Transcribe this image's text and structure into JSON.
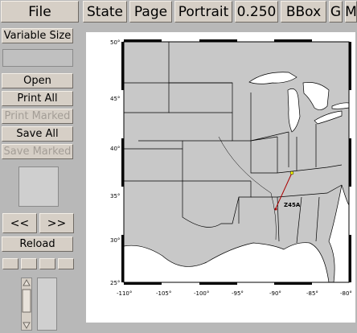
{
  "menu": {
    "file": "File",
    "state": "State",
    "page": "Page",
    "orientation": "Portrait",
    "scale": "0.250",
    "bbox": "BBox",
    "g": "G",
    "m": "M"
  },
  "sidebar": {
    "variable_size": "Variable Size",
    "open": "Open",
    "print_all": "Print All",
    "print_marked": "Print Marked",
    "save_all": "Save All",
    "save_marked": "Save Marked",
    "prev": "<<",
    "next": ">>",
    "reload": "Reload"
  },
  "map": {
    "lat_ticks": [
      "50°",
      "45°",
      "40°",
      "35°",
      "30°",
      "25°"
    ],
    "lon_ticks": [
      "-110°",
      "-105°",
      "-100°",
      "-95°",
      "-90°",
      "-85°",
      "-80°"
    ],
    "station_label": "Z45A",
    "colors": {
      "land": "#c8c8c8",
      "water": "#ffffff",
      "frame": "#000000",
      "path": "#aa0000"
    }
  }
}
